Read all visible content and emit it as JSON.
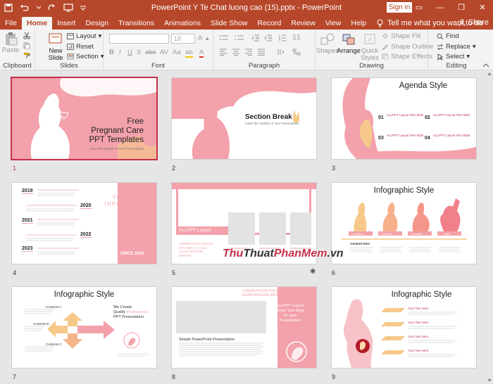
{
  "titlebar": {
    "title": "PowerPoint Y Te Chat luong cao (15).pptx  -  PowerPoint",
    "signin": "Sign in",
    "autosave_icon": "save-icon",
    "undo_icon": "undo-icon",
    "redo_icon": "redo-icon",
    "present_icon": "present-icon"
  },
  "tabs": [
    {
      "label": "File"
    },
    {
      "label": "Home"
    },
    {
      "label": "Insert"
    },
    {
      "label": "Design"
    },
    {
      "label": "Transitions"
    },
    {
      "label": "Animations"
    },
    {
      "label": "Slide Show"
    },
    {
      "label": "Record"
    },
    {
      "label": "Review"
    },
    {
      "label": "View"
    },
    {
      "label": "Help"
    }
  ],
  "tellme": "Tell me what you want to do",
  "share": "Share",
  "ribbon": {
    "clipboard": {
      "label": "Clipboard",
      "paste": "Paste"
    },
    "slides": {
      "label": "Slides",
      "new_slide_line1": "New",
      "new_slide_line2": "Slide",
      "layout": "Layout",
      "reset": "Reset",
      "section": "Section"
    },
    "font": {
      "label": "Font",
      "size": "18"
    },
    "paragraph": {
      "label": "Paragraph"
    },
    "drawing": {
      "label": "Drawing",
      "shapes": "Shapes",
      "arrange": "Arrange",
      "quick_styles_line1": "Quick",
      "quick_styles_line2": "Styles",
      "shape_fill": "Shape Fill",
      "shape_outline": "Shape Outline",
      "shape_effects": "Shape Effects"
    },
    "editing": {
      "label": "Editing",
      "find": "Find",
      "replace": "Replace",
      "select": "Select"
    }
  },
  "slides": [
    {
      "num": "1",
      "title_lines": [
        "Free",
        "Pregnant Care",
        "PPT Templates"
      ],
      "subtitle": "Insert the Subtitle of Your Presentation"
    },
    {
      "num": "2",
      "title": "Section Break",
      "subtitle": "Insert the Subtitle of Your Presentation"
    },
    {
      "num": "3",
      "title": "Agenda Style",
      "items": [
        {
          "n": "01",
          "t": "ALLPPT Layout Text Slide"
        },
        {
          "n": "02",
          "t": "ALLPPT Layout Text Slide"
        },
        {
          "n": "03",
          "t": "ALLPPT Layout Text Slide"
        },
        {
          "n": "04",
          "t": "ALLPPT Layout Text Slide"
        }
      ]
    },
    {
      "num": "4",
      "years": [
        "2019",
        "2020",
        "2021",
        "2022",
        "2023"
      ],
      "heading_lines": [
        "TIMELINE",
        "INFOGRAPHIC"
      ],
      "since": "SINCE 2015"
    },
    {
      "num": "5",
      "layout": "ALLPPT Layout",
      "lorem": "LOREM IPSUM DOLOR SIT AMET, CU USU AGAM INTEGRE IMPEDIT."
    },
    {
      "num": "6",
      "title": "Infographic Style",
      "stages": [
        "1 months",
        "3 months",
        "6 months",
        "birth"
      ],
      "content_label": "Content Here"
    },
    {
      "num": "7",
      "title": "Infographic Style",
      "we_create": "We Create",
      "quality": "Quality",
      "professional": "Professional",
      "ppt": "PPT Presentation",
      "content_labels": [
        "Contents A",
        "Contents B",
        "Contents C"
      ]
    },
    {
      "num": "8",
      "lorem": "LOREM IPSUM DOLOR SIT AMET, CU USU AGAM INTEGRE IMPEDIT.",
      "title": "Simple PowerPoint Presentation",
      "layout_lines": [
        "ALLPPT Layout",
        "Clean Text Slide",
        "for your",
        "Presentation"
      ]
    },
    {
      "num": "9",
      "title": "Infographic Style",
      "text_here": "Your Text Here"
    }
  ],
  "watermark": {
    "part1": "Thu",
    "part2": "Thuat",
    "part3": "PhanMem",
    "part4": ".vn"
  },
  "colors": {
    "accent": "#b7472a",
    "pink": "#f3a1aa",
    "selected": "#c4314b"
  }
}
